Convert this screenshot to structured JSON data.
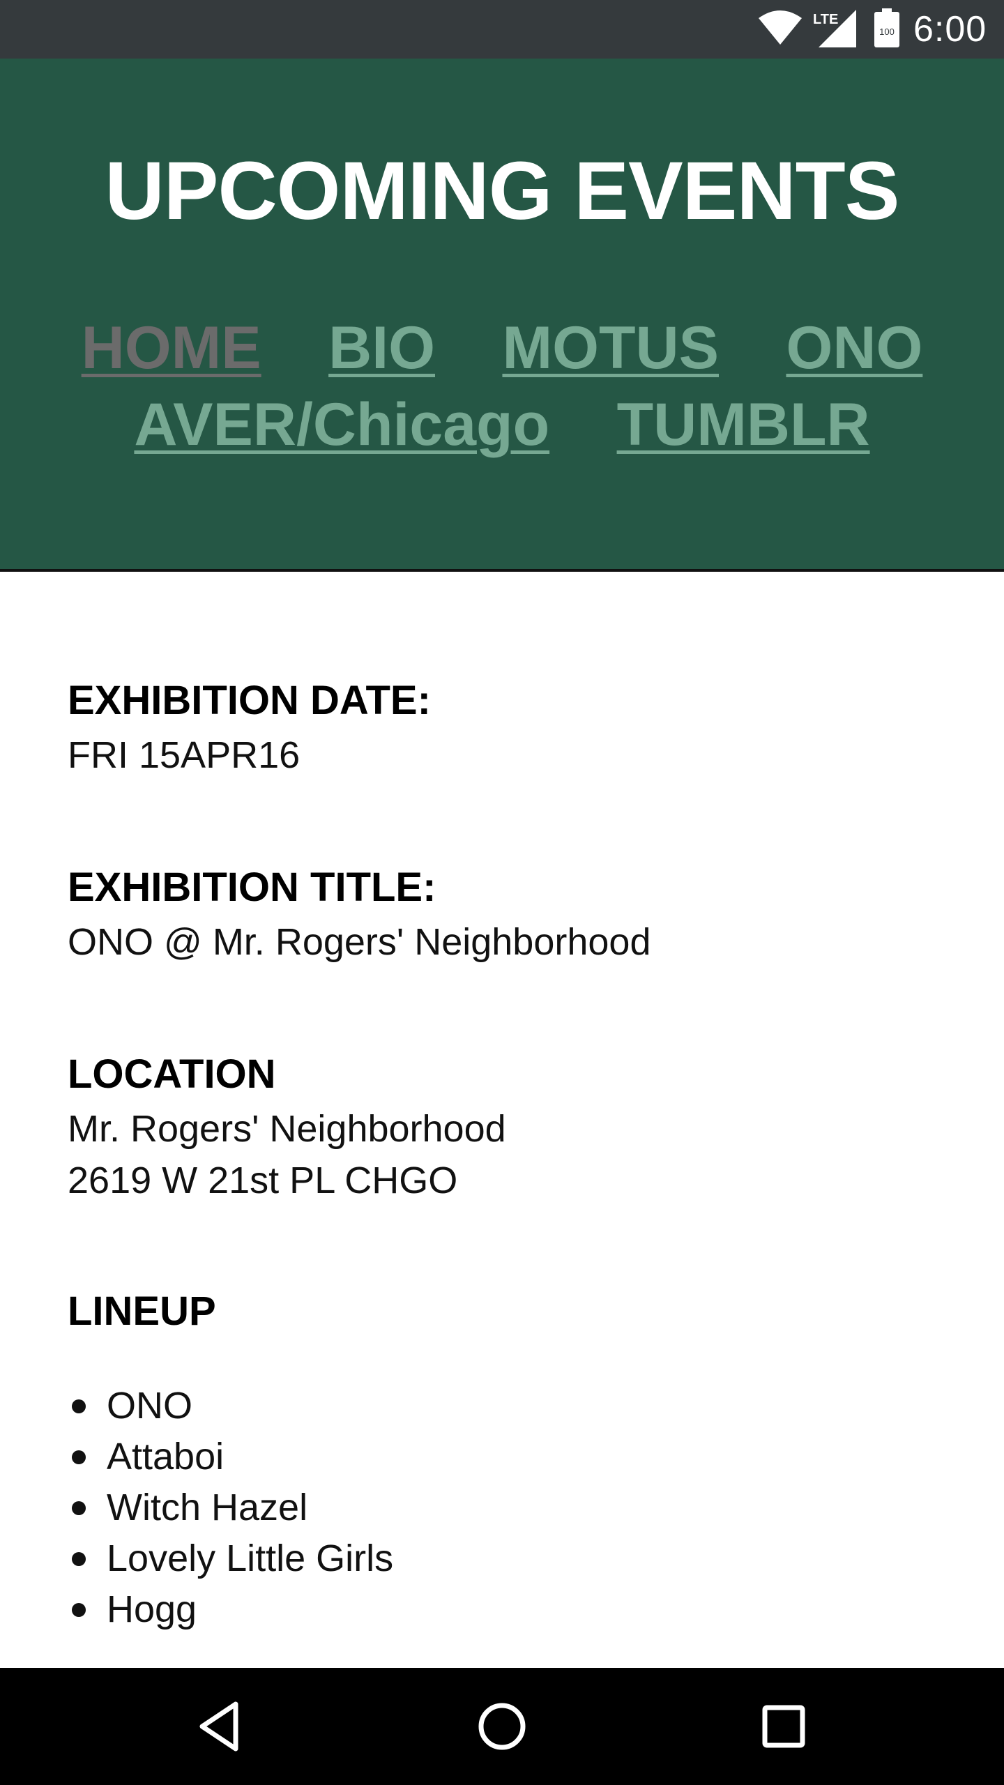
{
  "status_bar": {
    "time": "6:00",
    "network": "LTE",
    "battery": "100",
    "icons": [
      "wifi-icon",
      "cell-signal-icon",
      "battery-icon"
    ]
  },
  "header": {
    "title": "UPCOMING EVENTS",
    "nav": [
      {
        "label": "HOME",
        "active": true
      },
      {
        "label": "BIO"
      },
      {
        "label": "MOTUS"
      },
      {
        "label": "ONO"
      },
      {
        "label": "AVER/Chicago"
      },
      {
        "label": "TUMBLR"
      }
    ]
  },
  "event": {
    "date_label": "EXHIBITION DATE:",
    "date_value": "FRI 15APR16",
    "title_label": "EXHIBITION TITLE:",
    "title_value": "ONO @ Mr. Rogers' Neighborhood",
    "location_label": "LOCATION",
    "location_name": "Mr. Rogers' Neighborhood",
    "location_address": "2619 W 21st PL CHGO",
    "lineup_label": "LINEUP",
    "lineup": [
      "ONO",
      "Attaboi",
      "Witch Hazel",
      "Lovely Little Girls",
      "Hogg"
    ]
  },
  "colors": {
    "header_bg": "#255745",
    "nav_link": "#76a892",
    "nav_active": "#6b6b6b",
    "status_bar_bg": "#353a3d"
  },
  "system_nav": [
    "back-icon",
    "home-icon",
    "recents-icon"
  ]
}
